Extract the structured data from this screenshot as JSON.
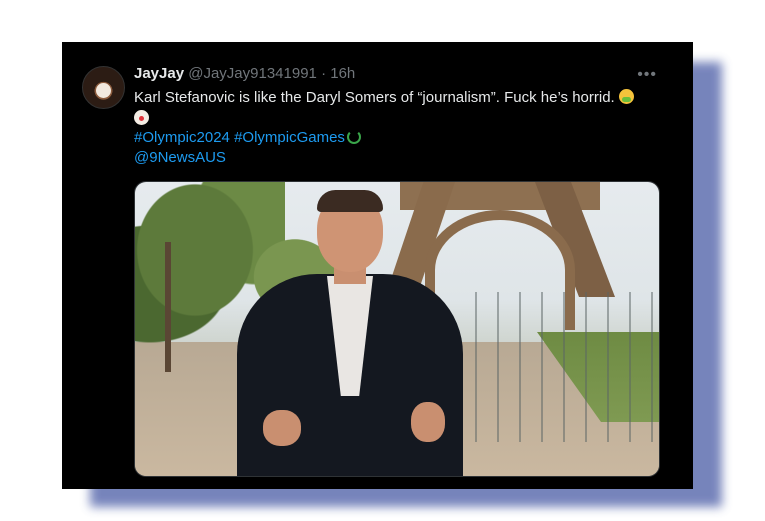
{
  "tweet": {
    "display_name": "JayJay",
    "handle": "@JayJay91341991",
    "separator": "·",
    "time": "16h",
    "more_icon": "ellipsis-icon",
    "text": "Karl Stefanovic is like the Daryl Somers of “journalism”. Fuck he’s horrid.",
    "emoji_1": "nauseated-face-icon",
    "emoji_2": "clown-face-icon",
    "hashtag_1": "#Olympic2024",
    "hashtag_2": "#OlympicGames",
    "hashtag_icon": "laurel-wreath-icon",
    "mention": "@9NewsAUS"
  },
  "colors": {
    "background": "#000000",
    "text": "#e7e9ea",
    "secondary": "#71767b",
    "link": "#1d9bf0",
    "shadow": "#5f6fb0"
  }
}
